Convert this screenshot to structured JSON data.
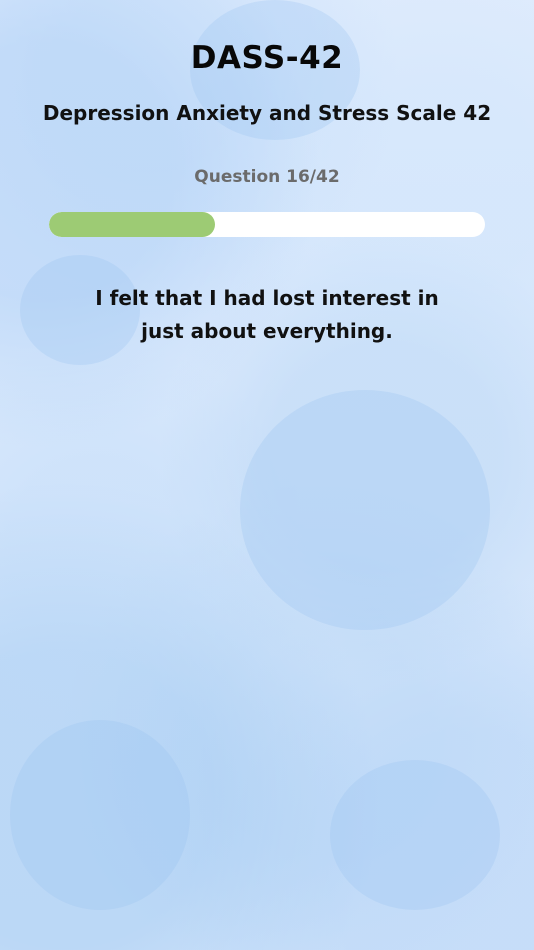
{
  "header": {
    "title": "DASS-42",
    "subtitle": "Depression Anxiety and Stress Scale 42"
  },
  "progress": {
    "label": "Question 16/42",
    "current": 16,
    "total": 42,
    "fill_color": "#9dcb74",
    "track_color": "#ffffff"
  },
  "question": {
    "text": "I felt that I had lost interest in just about everything."
  },
  "colors": {
    "background": "#dbe9fd",
    "title_text": "#080808",
    "counter_text": "#6b6b6b"
  }
}
